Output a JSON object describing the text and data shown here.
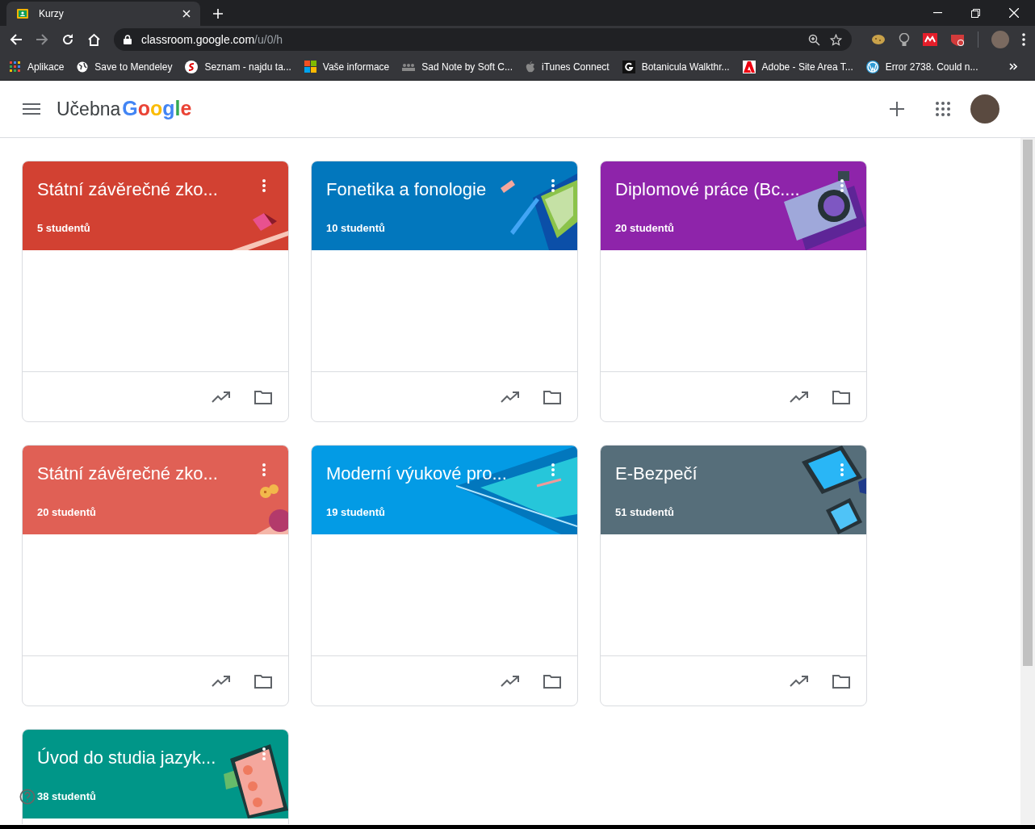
{
  "browser": {
    "tab_title": "Kurzy",
    "url_host": "classroom.google.com",
    "url_path": "/u/0/h",
    "bookmarks": [
      {
        "label": "Aplikace",
        "kind": "apps"
      },
      {
        "label": "Save to Mendeley",
        "kind": "globe"
      },
      {
        "label": "Seznam - najdu ta...",
        "kind": "seznam"
      },
      {
        "label": "Vaše informace",
        "kind": "windows"
      },
      {
        "label": "Sad Note by Soft C...",
        "kind": "people"
      },
      {
        "label": "iTunes Connect",
        "kind": "apple"
      },
      {
        "label": "Botanicula Walkthr...",
        "kind": "g"
      },
      {
        "label": "Adobe - Site Area T...",
        "kind": "adobe"
      },
      {
        "label": "Error 2738. Could n...",
        "kind": "wordpress"
      }
    ]
  },
  "app": {
    "name": "Učebna",
    "brand": "Google"
  },
  "courses": [
    {
      "title": "Státní závěrečné zko...",
      "students": "5 studentů",
      "color": "#d24132",
      "kind": "shapes"
    },
    {
      "title": "Fonetika a fonologie",
      "students": "10 studentů",
      "color": "#0277bd",
      "kind": "pen"
    },
    {
      "title": "Diplomové práce (Bc....",
      "students": "20 studentů",
      "color": "#8e24aa",
      "kind": "camera"
    },
    {
      "title": "Státní závěrečné zko...",
      "students": "20 studentů",
      "color": "#e06055",
      "kind": "coins"
    },
    {
      "title": "Moderní výukové pro...",
      "students": "19 studentů",
      "color": "#039be5",
      "kind": "pool"
    },
    {
      "title": "E-Bezpečí",
      "students": "51 studentů",
      "color": "#566e7a",
      "kind": "tablet"
    },
    {
      "title": "Úvod do studia jazyk...",
      "students": "38 studentů",
      "color": "#009688",
      "kind": "phone"
    }
  ]
}
